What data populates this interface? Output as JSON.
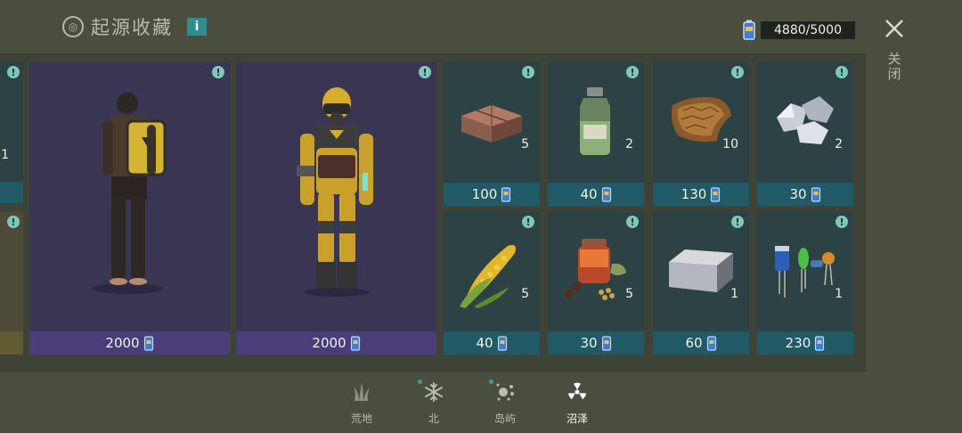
{
  "header": {
    "title": "起源收藏",
    "logo_glyph": "◎",
    "info_glyph": "i"
  },
  "currency": {
    "value": "4880/5000",
    "icon": "battery-coin-icon"
  },
  "close": {
    "label": "关闭"
  },
  "partial_cards": [
    {
      "qty": "1"
    }
  ],
  "outfits": [
    {
      "name": "backpack-outfit",
      "price": "2000"
    },
    {
      "name": "hazmat-suit-outfit",
      "price": "2000"
    }
  ],
  "items": [
    {
      "name": "bricks",
      "qty": "5",
      "price": "100"
    },
    {
      "name": "chemical-jar",
      "qty": "2",
      "price": "40"
    },
    {
      "name": "leather",
      "qty": "10",
      "price": "130"
    },
    {
      "name": "metal-chunks",
      "qty": "2",
      "price": "30"
    },
    {
      "name": "corn",
      "qty": "5",
      "price": "40"
    },
    {
      "name": "spices",
      "qty": "5",
      "price": "30"
    },
    {
      "name": "iron-ingot",
      "qty": "1",
      "price": "60"
    },
    {
      "name": "electronic-components",
      "qty": "1",
      "price": "230"
    }
  ],
  "tabs": [
    {
      "label": "荒地",
      "icon": "grass-icon",
      "active": false
    },
    {
      "label": "北",
      "icon": "snowflake-icon",
      "active": false
    },
    {
      "label": "岛屿",
      "icon": "island-icon",
      "active": false
    },
    {
      "label": "沼泽",
      "icon": "radiation-icon",
      "active": true
    }
  ],
  "colors": {
    "background": "#494e3f",
    "outfit_card": "#3a3553",
    "outfit_price_bar": "#4b3d7a",
    "item_card": "#2d4244",
    "item_price_bar": "#1f5a66",
    "alert": "#7fc7b9",
    "accent": "#2e8e8e"
  }
}
